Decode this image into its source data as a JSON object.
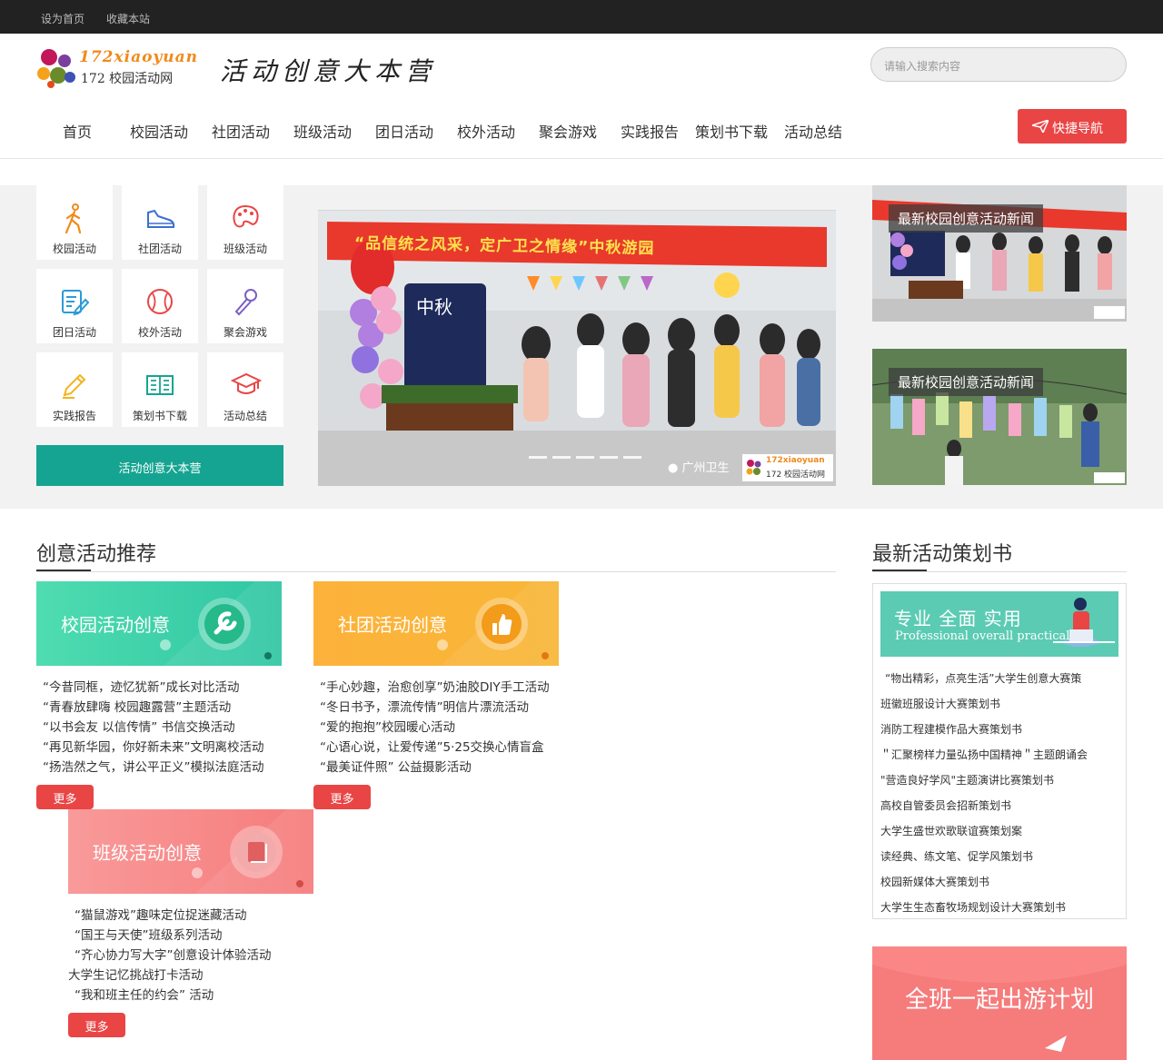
{
  "topbar": {
    "set_home": "设为首页",
    "bookmark": "收藏本站"
  },
  "logo": {
    "text_en": "172xiaoyuan",
    "text_cn": "172 校园活动网"
  },
  "slogan": "活动创意大本营",
  "search": {
    "placeholder": "请输入搜索内容"
  },
  "nav": [
    "首页",
    "校园活动",
    "社团活动",
    "班级活动",
    "团日活动",
    "校外活动",
    "聚会游戏",
    "实践报告",
    "策划书下载",
    "活动总结"
  ],
  "quick_nav": "快捷导航",
  "categories": [
    "校园活动",
    "社团活动",
    "班级活动",
    "团日活动",
    "校外活动",
    "聚会游戏",
    "实践报告",
    "策划书下载",
    "活动总结"
  ],
  "green_button": "活动创意大本营",
  "slider": {
    "banner_text": "“品信统之风采，定广卫之情缘”中秋游园",
    "board_text": "中秋",
    "watermark": "广州卫生",
    "logo_en": "172xiaoyuan",
    "logo_cn": "172 校园活动网"
  },
  "side_news": [
    "最新校园创意活动新闻",
    "最新校园创意活动新闻"
  ],
  "section_left": {
    "title": "创意活动推荐"
  },
  "cards": [
    {
      "title": "校园活动创意",
      "color": "#3fd3a5",
      "items": [
        "“今昔同框，迹忆犹新”成长对比活动",
        "“青春放肆嗨 校园趣露营”主题活动",
        "“以书会友 以信传情” 书信交换活动",
        "“再见新华园，你好新未来”文明离校活动",
        "“扬浩然之气，讲公平正义”模拟法庭活动"
      ],
      "more": "更多"
    },
    {
      "title": "社团活动创意",
      "color": "#f9b233",
      "items": [
        "“手心妙趣，治愈创享”奶油胶DIY手工活动",
        "“冬日书予，漂流传情”明信片漂流活动",
        "“爱的抱抱”校园暖心活动",
        "“心语心说，让爱传递”5·25交换心情盲盒",
        "“最美证件照” 公益摄影活动"
      ],
      "more": "更多"
    },
    {
      "title": "班级活动创意",
      "color": "#f67b7b",
      "items": [
        "“猫鼠游戏”趣味定位捉迷藏活动",
        "“国王与天使”班级系列活动",
        "“齐心协力写大字”创意设计体验活动",
        "大学生记忆挑战打卡活动",
        "“我和班主任的约会” 活动"
      ],
      "more": "更多"
    }
  ],
  "section_right": {
    "title": "最新活动策划书"
  },
  "right_banner": {
    "cn": "专业 全面 实用",
    "en": "Professional overall practical"
  },
  "right_list": [
    "“物出精彩，点亮生活”大学生创意大赛策",
    "班徽班服设计大赛策划书",
    "消防工程建模作品大赛策划书",
    "＂汇聚榜样力量弘扬中国精神＂主题朗诵会",
    "\"营造良好学风\"主题演讲比赛策划书",
    "高校自管委员会招新策划书",
    "大学生盛世欢歌联谊赛策划案",
    "读经典、练文笔、促学风策划书",
    "校园新媒体大赛策划书",
    "大学生生态畜牧场规划设计大赛策划书"
  ],
  "travel": "全班一起出游计划"
}
